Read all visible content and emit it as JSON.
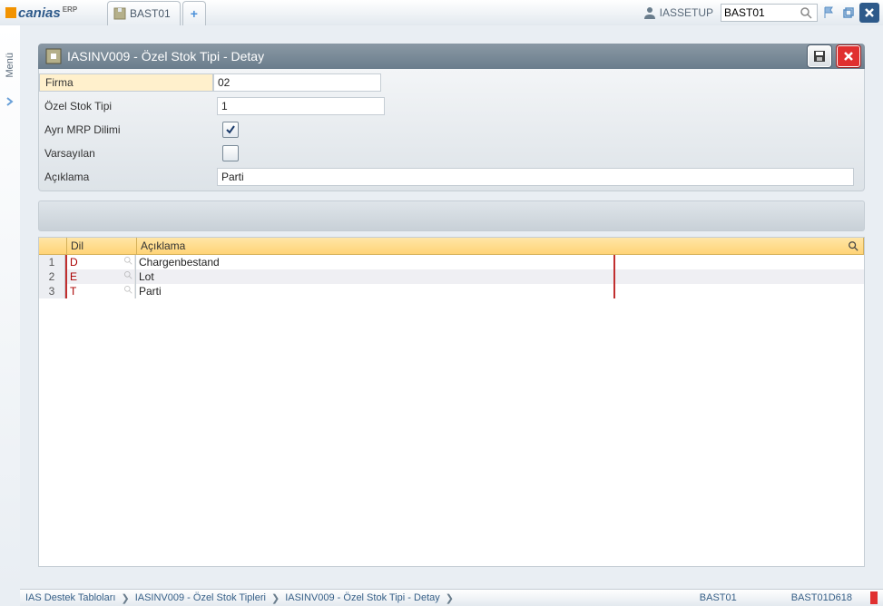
{
  "topbar": {
    "logo_main": "canias",
    "logo_sup": "ERP",
    "tab_label": "BAST01",
    "user": "IASSETUP",
    "search_value": "BAST01"
  },
  "leftrail": {
    "menu": "Menü"
  },
  "panel": {
    "title": "IASINV009 - Özel Stok Tipi - Detay"
  },
  "form": {
    "firma_label": "Firma",
    "firma_value": "02",
    "tip_label": "Özel Stok Tipi",
    "tip_value": "1",
    "mrp_label": "Ayrı MRP Dilimi",
    "mrp_checked": true,
    "default_label": "Varsayılan",
    "default_checked": false,
    "desc_label": "Açıklama",
    "desc_value": "Parti"
  },
  "table": {
    "col_dil": "Dil",
    "col_aciklama": "Açıklama",
    "rows": [
      {
        "n": "1",
        "dil": "D",
        "aciklama": "Chargenbestand"
      },
      {
        "n": "2",
        "dil": "E",
        "aciklama": "Lot"
      },
      {
        "n": "3",
        "dil": "T",
        "aciklama": "Parti"
      }
    ]
  },
  "breadcrumb": {
    "c1": "IAS Destek Tabloları",
    "c2": "IASINV009 - Özel Stok Tipleri",
    "c3": "IASINV009 - Özel Stok Tipi - Detay",
    "code1": "BAST01",
    "code2": "BAST01D618"
  }
}
